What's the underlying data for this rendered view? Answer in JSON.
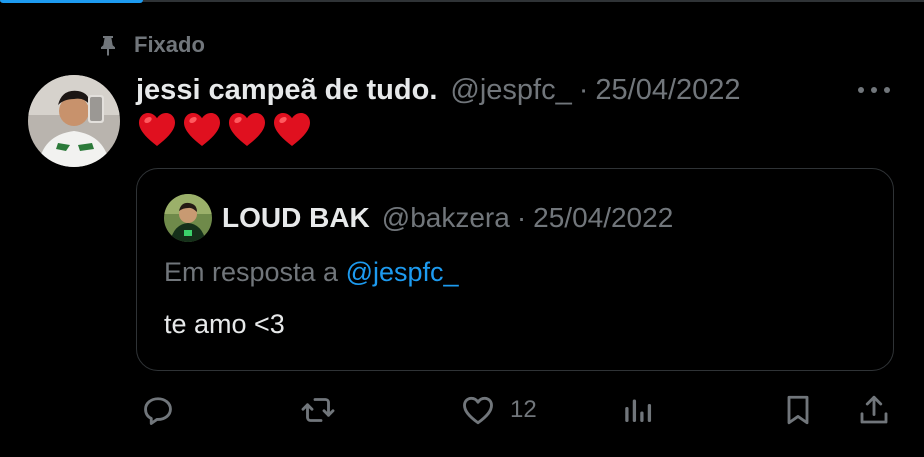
{
  "pinned": {
    "label": "Fixado",
    "icon": "pin-icon"
  },
  "post": {
    "author_name": "jessi campeã de tudo.",
    "author_handle": "@jespfc_",
    "separator": "·",
    "date": "25/04/2022",
    "text": "❤️❤️❤️❤️",
    "heart_count": 4,
    "more_icon": "more-icon"
  },
  "quote": {
    "author_name": "LOUD BAK",
    "author_handle": "@bakzera",
    "separator": "·",
    "date": "25/04/2022",
    "reply_prefix": "Em resposta a",
    "reply_to": "@jespfc_",
    "text": "te amo <3"
  },
  "actions": {
    "reply_icon": "reply-icon",
    "repost_icon": "repost-icon",
    "like_icon": "heart-icon",
    "like_count": "12",
    "views_icon": "views-icon",
    "bookmark_icon": "bookmark-icon",
    "share_icon": "share-icon"
  },
  "colors": {
    "background": "#000000",
    "text_primary": "#e7e9ea",
    "text_secondary": "#71767b",
    "accent": "#1d9bf0",
    "border": "#2f3336",
    "heart_red": "#e0101f"
  }
}
